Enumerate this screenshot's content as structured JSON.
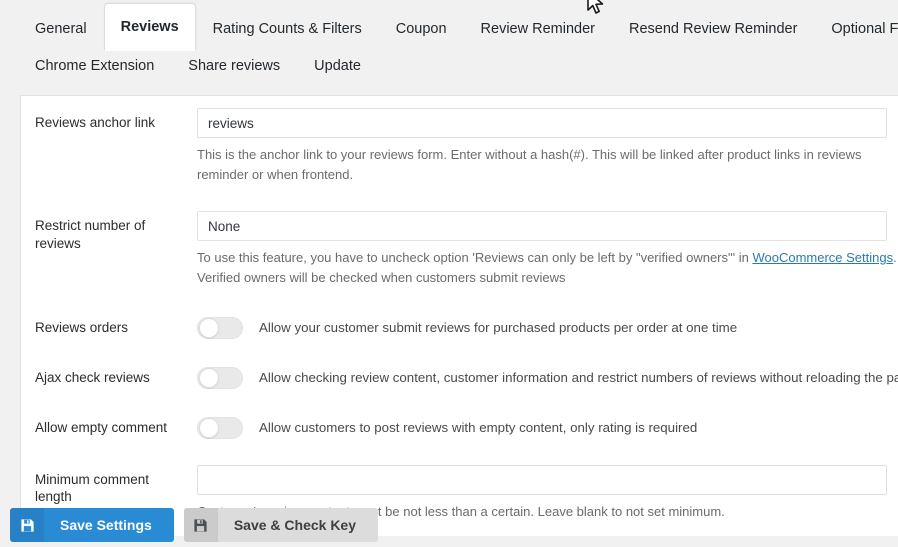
{
  "tabs": {
    "row1": [
      {
        "label": "General",
        "active": false
      },
      {
        "label": "Reviews",
        "active": true
      },
      {
        "label": "Rating Counts & Filters",
        "active": false
      },
      {
        "label": "Coupon",
        "active": false
      },
      {
        "label": "Review Reminder",
        "active": false
      },
      {
        "label": "Resend Review Reminder",
        "active": false
      },
      {
        "label": "Optional Fields",
        "active": false
      }
    ],
    "row2": [
      {
        "label": "Chrome Extension",
        "active": false
      },
      {
        "label": "Share reviews",
        "active": false
      },
      {
        "label": "Update",
        "active": false
      }
    ]
  },
  "fields": {
    "anchor_link": {
      "label": "Reviews anchor link",
      "value": "reviews",
      "placeholder": "",
      "help_before": "This is the anchor link to your reviews form. Enter without a hash(#). This will be linked after product links in reviews reminder or when frontend."
    },
    "restrict_reviews": {
      "label": "Restrict number of reviews",
      "value": "None",
      "options": [
        "None"
      ],
      "help_part1": "To use this feature, you have to uncheck option 'Reviews can only be left by \"verified owners\"' in ",
      "help_link": "WooCommerce Settings",
      "help_part2": ". Verified owners will be checked when customers submit reviews"
    },
    "reviews_orders": {
      "label": "Reviews orders",
      "description": "Allow your customer submit reviews for purchased products per order at one time",
      "state": "off"
    },
    "ajax_check_reviews": {
      "label": "Ajax check reviews",
      "description": "Allow checking review content, customer information and restrict numbers of reviews without reloading the page",
      "state": "off"
    },
    "allow_empty_comment": {
      "label": "Allow empty comment",
      "description": "Allow customers to post reviews with empty content, only rating is required",
      "state": "off"
    },
    "minimum_comment_length": {
      "label": "Minimum comment length",
      "value": "",
      "help": "Customer's review content must be not less than a certain. Leave blank to not set minimum."
    }
  },
  "footer": {
    "save_settings_label": "Save Settings",
    "save_check_key_label": "Save & Check Key",
    "save_icon": "floppy-disk-icon"
  },
  "colors": {
    "primary": "#2a8bd5",
    "secondary": "#dcdcdc",
    "page_bg": "#f1f1f1",
    "panel_bg": "#ffffff",
    "link": "#2a7ab0"
  }
}
